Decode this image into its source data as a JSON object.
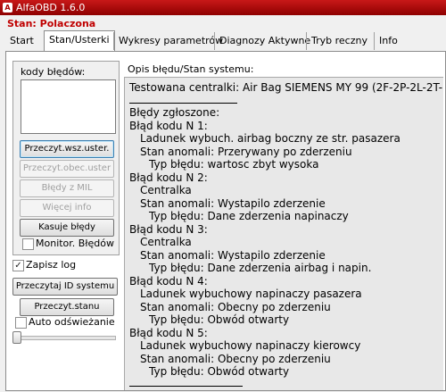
{
  "window": {
    "title": "AlfaOBD 1.6.0"
  },
  "status": "Stan: Polaczona",
  "tabs": [
    "Start",
    "Stan/Usterki",
    "Wykresy parametrów",
    "Diagnozy Aktywne",
    "Tryb reczny",
    "Info"
  ],
  "active_tab": "Stan/Usterki",
  "left": {
    "codes_label": "kody błędów:",
    "buttons": {
      "read_all": "Przeczyt.wsz.uster.",
      "read_current": "Przeczyt.obec.uster",
      "mil_errors": "Błędy z MIL",
      "more_info": "Więcej info",
      "clear_errors": "Kasuje błędy"
    },
    "monitor_label": "Monitor. Błędów",
    "monitor_checked": false,
    "save_log_label": "Zapisz log",
    "save_log_checked": true,
    "read_id_button": "Przeczytaj ID systemu",
    "read_state_button": "Przeczyt.stanu",
    "auto_refresh_label": "Auto odświeżanie",
    "auto_refresh_checked": false,
    "slider_level": 0
  },
  "right": {
    "title": "Opis błędu/Stan systemu:",
    "lines": [
      "Testowana centralki: Air Bag SIEMENS MY 99 (2F-2P-2L-2T-I)",
      "Błędy zgłoszone:",
      "Błąd kodu N 1:",
      "Ladunek wybuch. airbag boczny ze str. pasazera",
      "Stan anomali: Przerywany po zderzeniu",
      "Typ błędu: wartosc zbyt wysoka",
      "Błąd kodu N 2:",
      "Centralka",
      "Stan anomali: Wystapilo zderzenie",
      "Typ błędu: Dane zderzenia napinaczy",
      "Błąd kodu N 3:",
      "Centralka",
      "Stan anomali: Wystapilo zderzenie",
      "Typ błędu: Dane zderzenia airbag i napin.",
      "Błąd kodu N 4:",
      "Ladunek wybuchowy napinaczy pasazera",
      "Stan anomali: Obecny po zderzeniu",
      "Typ błędu: Obwód otwarty",
      "Błąd kodu N 5:",
      "Ladunek wybuchowy napinaczy kierowcy",
      "Stan anomali: Obecny po zderzeniu",
      "Typ błędu: Obwód otwarty"
    ]
  }
}
